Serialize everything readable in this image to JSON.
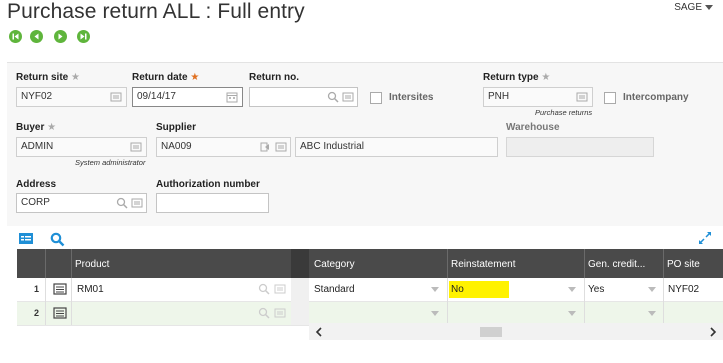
{
  "header": {
    "title": "Purchase return ALL : Full entry",
    "user": "SAGE",
    "nav": [
      "first-icon",
      "previous-icon",
      "next-icon",
      "last-icon"
    ]
  },
  "form": {
    "return_site": {
      "label": "Return site",
      "value": "NYF02"
    },
    "return_date": {
      "label": "Return date",
      "value": "09/14/17"
    },
    "return_no": {
      "label": "Return no.",
      "value": ""
    },
    "intersites": {
      "label": "Intersites",
      "checked": false
    },
    "return_type": {
      "label": "Return type",
      "value": "PNH",
      "hint": "Purchase returns"
    },
    "intercompany": {
      "label": "Intercompany",
      "checked": false
    },
    "buyer": {
      "label": "Buyer",
      "value": "ADMIN",
      "hint": "System administrator"
    },
    "supplier": {
      "label": "Supplier",
      "value": "NA009",
      "name": "ABC Industrial"
    },
    "warehouse": {
      "label": "Warehouse",
      "value": ""
    },
    "address": {
      "label": "Address",
      "value": "CORP"
    },
    "authorization": {
      "label": "Authorization number",
      "value": ""
    }
  },
  "grid": {
    "columns": [
      "Product",
      "Category",
      "Reinstatement",
      "Gen. credit...",
      "PO site"
    ],
    "rows": [
      {
        "num": "1",
        "product": "RM01",
        "category": "Standard",
        "reinstatement": "No",
        "gen_credit": "Yes",
        "po_site": "NYF02"
      },
      {
        "num": "2",
        "product": "",
        "category": "",
        "reinstatement": "",
        "gen_credit": "",
        "po_site": ""
      }
    ]
  },
  "colors": {
    "accent": "#5fb53c",
    "header": "#4a4a4a",
    "highlight": "#fff200",
    "link": "#1f8fd6"
  }
}
